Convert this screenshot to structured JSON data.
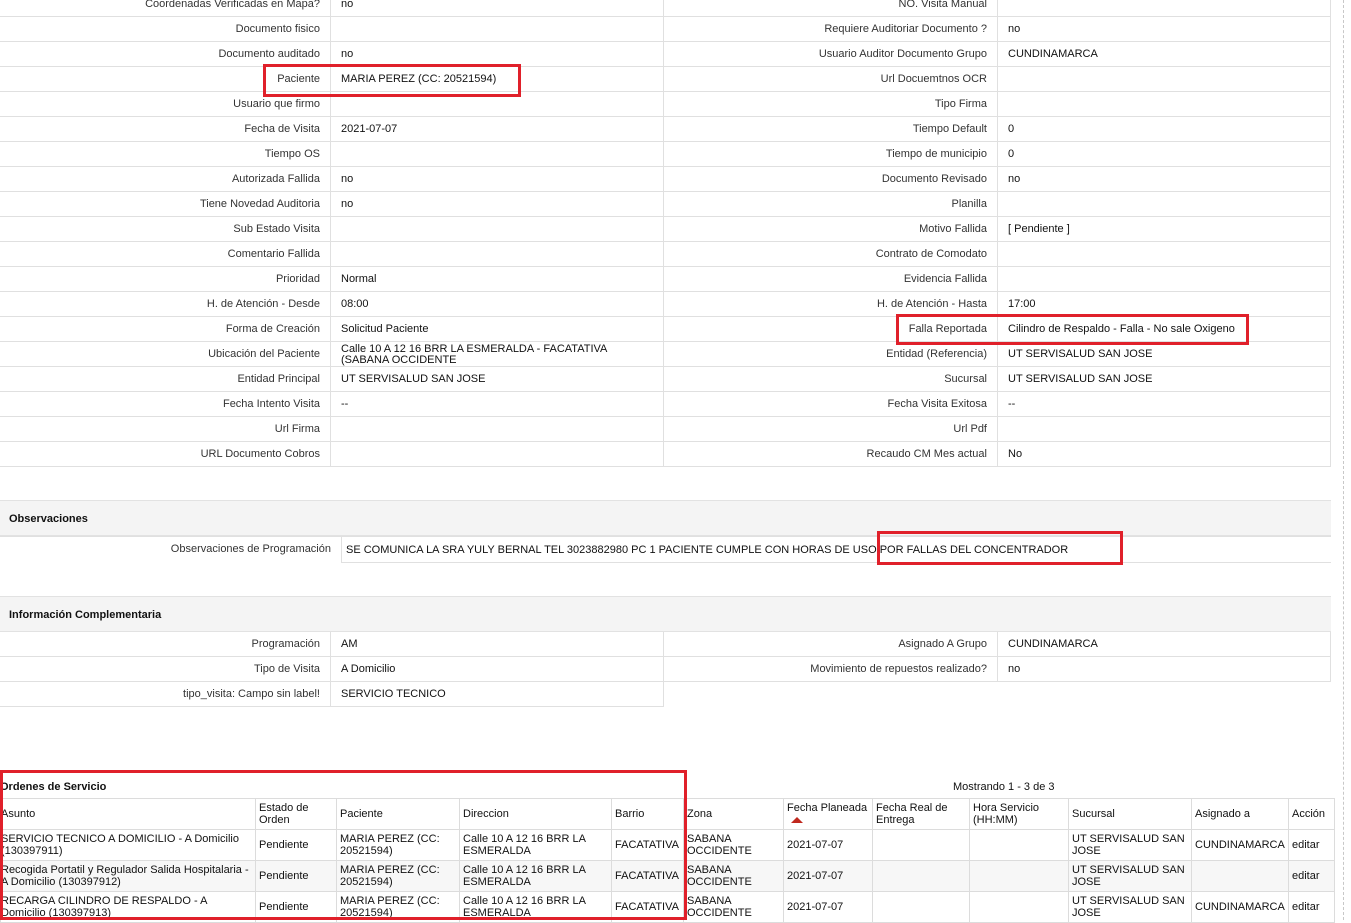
{
  "details": [
    {
      "l1": "Coordenadas Verificadas en Mapa?",
      "v1": "no",
      "l2": "NO. Visita Manual",
      "v2": ""
    },
    {
      "l1": "Documento fisico",
      "v1": "",
      "l2": "Requiere Auditoriar Documento ?",
      "v2": " no"
    },
    {
      "l1": "Documento auditado",
      "v1": "no",
      "l2": "Usuario Auditor Documento Grupo",
      "v2": "CUNDINAMARCA"
    },
    {
      "l1": "Paciente",
      "v1": "MARIA PEREZ (CC: 20521594)",
      "l2": "Url Docuemtnos OCR",
      "v2": ""
    },
    {
      "l1": "Usuario que firmo",
      "v1": "",
      "l2": "Tipo Firma",
      "v2": ""
    },
    {
      "l1": "Fecha de Visita",
      "v1": " 2021-07-07",
      "l2": "Tiempo Default",
      "v2": "0"
    },
    {
      "l1": "Tiempo OS",
      "v1": "",
      "l2": "Tiempo de municipio",
      "v2": "0"
    },
    {
      "l1": "Autorizada Fallida",
      "v1": "no",
      "l2": "Documento Revisado",
      "v2": " no"
    },
    {
      "l1": "Tiene Novedad Auditoria",
      "v1": "no",
      "l2": "Planilla",
      "v2": ""
    },
    {
      "l1": "Sub Estado Visita",
      "v1": "",
      "l2": "Motivo Fallida",
      "v2": "[ Pendiente ]"
    },
    {
      "l1": "Comentario Fallida",
      "v1": "",
      "l2": "Contrato de Comodato",
      "v2": ""
    },
    {
      "l1": "Prioridad",
      "v1": "Normal",
      "l2": "Evidencia Fallida",
      "v2": ""
    },
    {
      "l1": "H. de Atención - Desde",
      "v1": "08:00",
      "l2": "H. de Atención - Hasta",
      "v2": "17:00"
    },
    {
      "l1": "Forma de Creación",
      "v1": "Solicitud Paciente",
      "l2": "Falla Reportada",
      "v2": "Cilindro de Respaldo - Falla - No sale Oxigeno"
    },
    {
      "l1": "Ubicación del Paciente",
      "v1": "Calle 10 A 12 16 BRR LA ESMERALDA - FACATATIVA (SABANA OCCIDENTE",
      "l2": "Entidad (Referencia)",
      "v2": "UT SERVISALUD SAN JOSE"
    },
    {
      "l1": "Entidad Principal",
      "v1": "UT SERVISALUD SAN JOSE",
      "l2": "Sucursal",
      "v2": "UT SERVISALUD SAN JOSE"
    },
    {
      "l1": "Fecha Intento Visita",
      "v1": "--",
      "l2": "Fecha Visita Exitosa",
      "v2": " --"
    },
    {
      "l1": "Url Firma",
      "v1": "",
      "l2": "Url Pdf",
      "v2": ""
    },
    {
      "l1": "URL Documento Cobros",
      "v1": "",
      "l2": "Recaudo CM Mes actual",
      "v2": "No"
    }
  ],
  "observaciones": {
    "title": "Observaciones",
    "label": "Observaciones de Programación",
    "value": "SE COMUNICA LA SRA YULY BERNAL TEL 3023882980 PC 1 PACIENTE CUMPLE CON HORAS DE USO POR FALLAS DEL CONCENTRADOR"
  },
  "complementaria": {
    "title": "Información Complementaria",
    "rows": [
      {
        "l1": "Programación",
        "v1": "AM",
        "l2": "Asignado A Grupo",
        "v2": "CUNDINAMARCA"
      },
      {
        "l1": "Tipo de Visita",
        "v1": "A Domicilio",
        "l2": "Movimiento de repuestos realizado?",
        "v2": " no"
      },
      {
        "l1": "tipo_visita: Campo sin label!",
        "v1": "SERVICIO TECNICO",
        "l2": "",
        "v2": ""
      }
    ]
  },
  "orders": {
    "title": "Ordenes de Servicio",
    "count": "Mostrando 1 - 3 de 3",
    "headers": [
      "Asunto",
      "Estado de Orden",
      "Paciente",
      "Direccion",
      "Barrio",
      "Zona",
      "Fecha Planeada",
      "Fecha Real de Entrega",
      "Hora Servicio (HH:MM)",
      "Sucursal",
      "Asignado a",
      "Acción"
    ],
    "rows": [
      [
        "SERVICIO TECNICO A DOMICILIO - A Domicilio (130397911)",
        "Pendiente",
        "MARIA PEREZ (CC: 20521594)",
        "Calle 10 A 12 16 BRR LA ESMERALDA",
        "FACATATIVA",
        "SABANA OCCIDENTE",
        "2021-07-07",
        "",
        "",
        "UT SERVISALUD SAN JOSE",
        "CUNDINAMARCA",
        "editar"
      ],
      [
        "Recogida Portatil y Regulador Salida Hospitalaria - A Domicilio (130397912)",
        "Pendiente",
        "MARIA PEREZ (CC: 20521594)",
        "Calle 10 A 12 16 BRR LA ESMERALDA",
        "FACATATIVA",
        "SABANA OCCIDENTE",
        "2021-07-07",
        "",
        "",
        "UT SERVISALUD SAN JOSE",
        "",
        "editar"
      ],
      [
        "RECARGA CILINDRO DE RESPALDO - A Domicilio (130397913)",
        "Pendiente",
        "MARIA PEREZ (CC: 20521594)",
        "Calle 10 A 12 16 BRR LA ESMERALDA",
        "FACATATIVA",
        "SABANA OCCIDENTE",
        "2021-07-07",
        "",
        "",
        "UT SERVISALUD SAN JOSE",
        "CUNDINAMARCA",
        "editar"
      ]
    ]
  },
  "highlight_color": "#e0202a"
}
